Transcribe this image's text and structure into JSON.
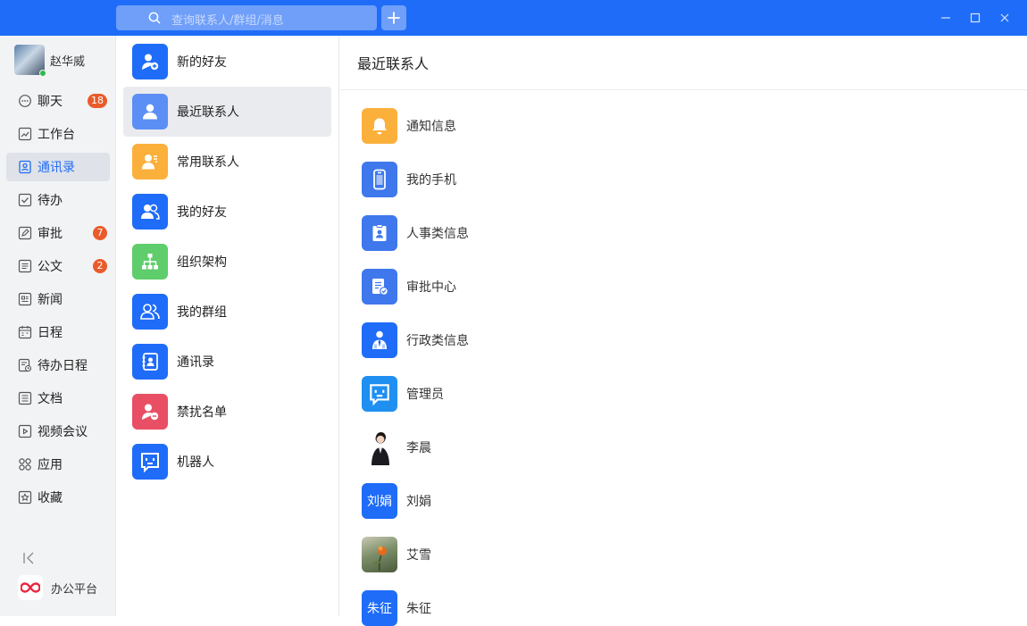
{
  "topbar": {
    "search_placeholder": "查询联系人/群组/消息",
    "accent_color": "#1f6cf8"
  },
  "user": {
    "name": "赵华威",
    "status": "online"
  },
  "nav": [
    {
      "label": "聊天",
      "icon": "chat-icon",
      "badge": "18"
    },
    {
      "label": "工作台",
      "icon": "workbench-icon"
    },
    {
      "label": "通讯录",
      "icon": "contacts-icon",
      "active": true
    },
    {
      "label": "待办",
      "icon": "todo-icon"
    },
    {
      "label": "审批",
      "icon": "approval-icon",
      "badge": "7"
    },
    {
      "label": "公文",
      "icon": "document-icon",
      "badge": "2"
    },
    {
      "label": "新闻",
      "icon": "news-icon"
    },
    {
      "label": "日程",
      "icon": "calendar-icon"
    },
    {
      "label": "待办日程",
      "icon": "todo-schedule-icon"
    },
    {
      "label": "文档",
      "icon": "docs-icon"
    },
    {
      "label": "视频会议",
      "icon": "video-icon"
    },
    {
      "label": "应用",
      "icon": "apps-icon"
    },
    {
      "label": "收藏",
      "icon": "favorites-icon"
    }
  ],
  "office_platform": "办公平台",
  "contacts_menu": [
    {
      "label": "新的好友",
      "icon": "add-friend-icon",
      "color": "#1f6cf8"
    },
    {
      "label": "最近联系人",
      "icon": "recent-contact-icon",
      "color": "#5b8ff5",
      "selected": true
    },
    {
      "label": "常用联系人",
      "icon": "frequent-contact-icon",
      "color": "#fbb03b"
    },
    {
      "label": "我的好友",
      "icon": "friends-icon",
      "color": "#1f6cf8"
    },
    {
      "label": "组织架构",
      "icon": "org-chart-icon",
      "color": "#5fcd6b"
    },
    {
      "label": "我的群组",
      "icon": "group-icon",
      "color": "#1f6cf8"
    },
    {
      "label": "通讯录",
      "icon": "address-book-icon",
      "color": "#1f6cf8"
    },
    {
      "label": "禁扰名单",
      "icon": "blocked-icon",
      "color": "#e94f64"
    },
    {
      "label": "机器人",
      "icon": "robot-icon",
      "color": "#1f6cf8"
    }
  ],
  "recent": {
    "title": "最近联系人",
    "items": [
      {
        "label": "通知信息",
        "icon": "bell-icon",
        "color": "#fbb03b"
      },
      {
        "label": "我的手机",
        "icon": "phone-icon",
        "color": "#3f78ec"
      },
      {
        "label": "人事类信息",
        "icon": "hr-icon",
        "color": "#3f78ec"
      },
      {
        "label": "审批中心",
        "icon": "approval-center-icon",
        "color": "#3f78ec"
      },
      {
        "label": "行政类信息",
        "icon": "admin-icon",
        "color": "#1f6cf8"
      },
      {
        "label": "管理员",
        "icon": "robot-icon",
        "color": "#1f8ff2"
      },
      {
        "label": "李晨",
        "icon": "avatar-photo",
        "color": "#ffffff"
      },
      {
        "label": "刘娟",
        "icon": "text-avatar",
        "avatar_text": "刘娟",
        "color": "#1f6cf8"
      },
      {
        "label": "艾雪",
        "icon": "avatar-photo",
        "color": "#8a9a6c"
      },
      {
        "label": "朱征",
        "icon": "text-avatar",
        "avatar_text": "朱征",
        "color": "#1f6cf8"
      }
    ]
  }
}
